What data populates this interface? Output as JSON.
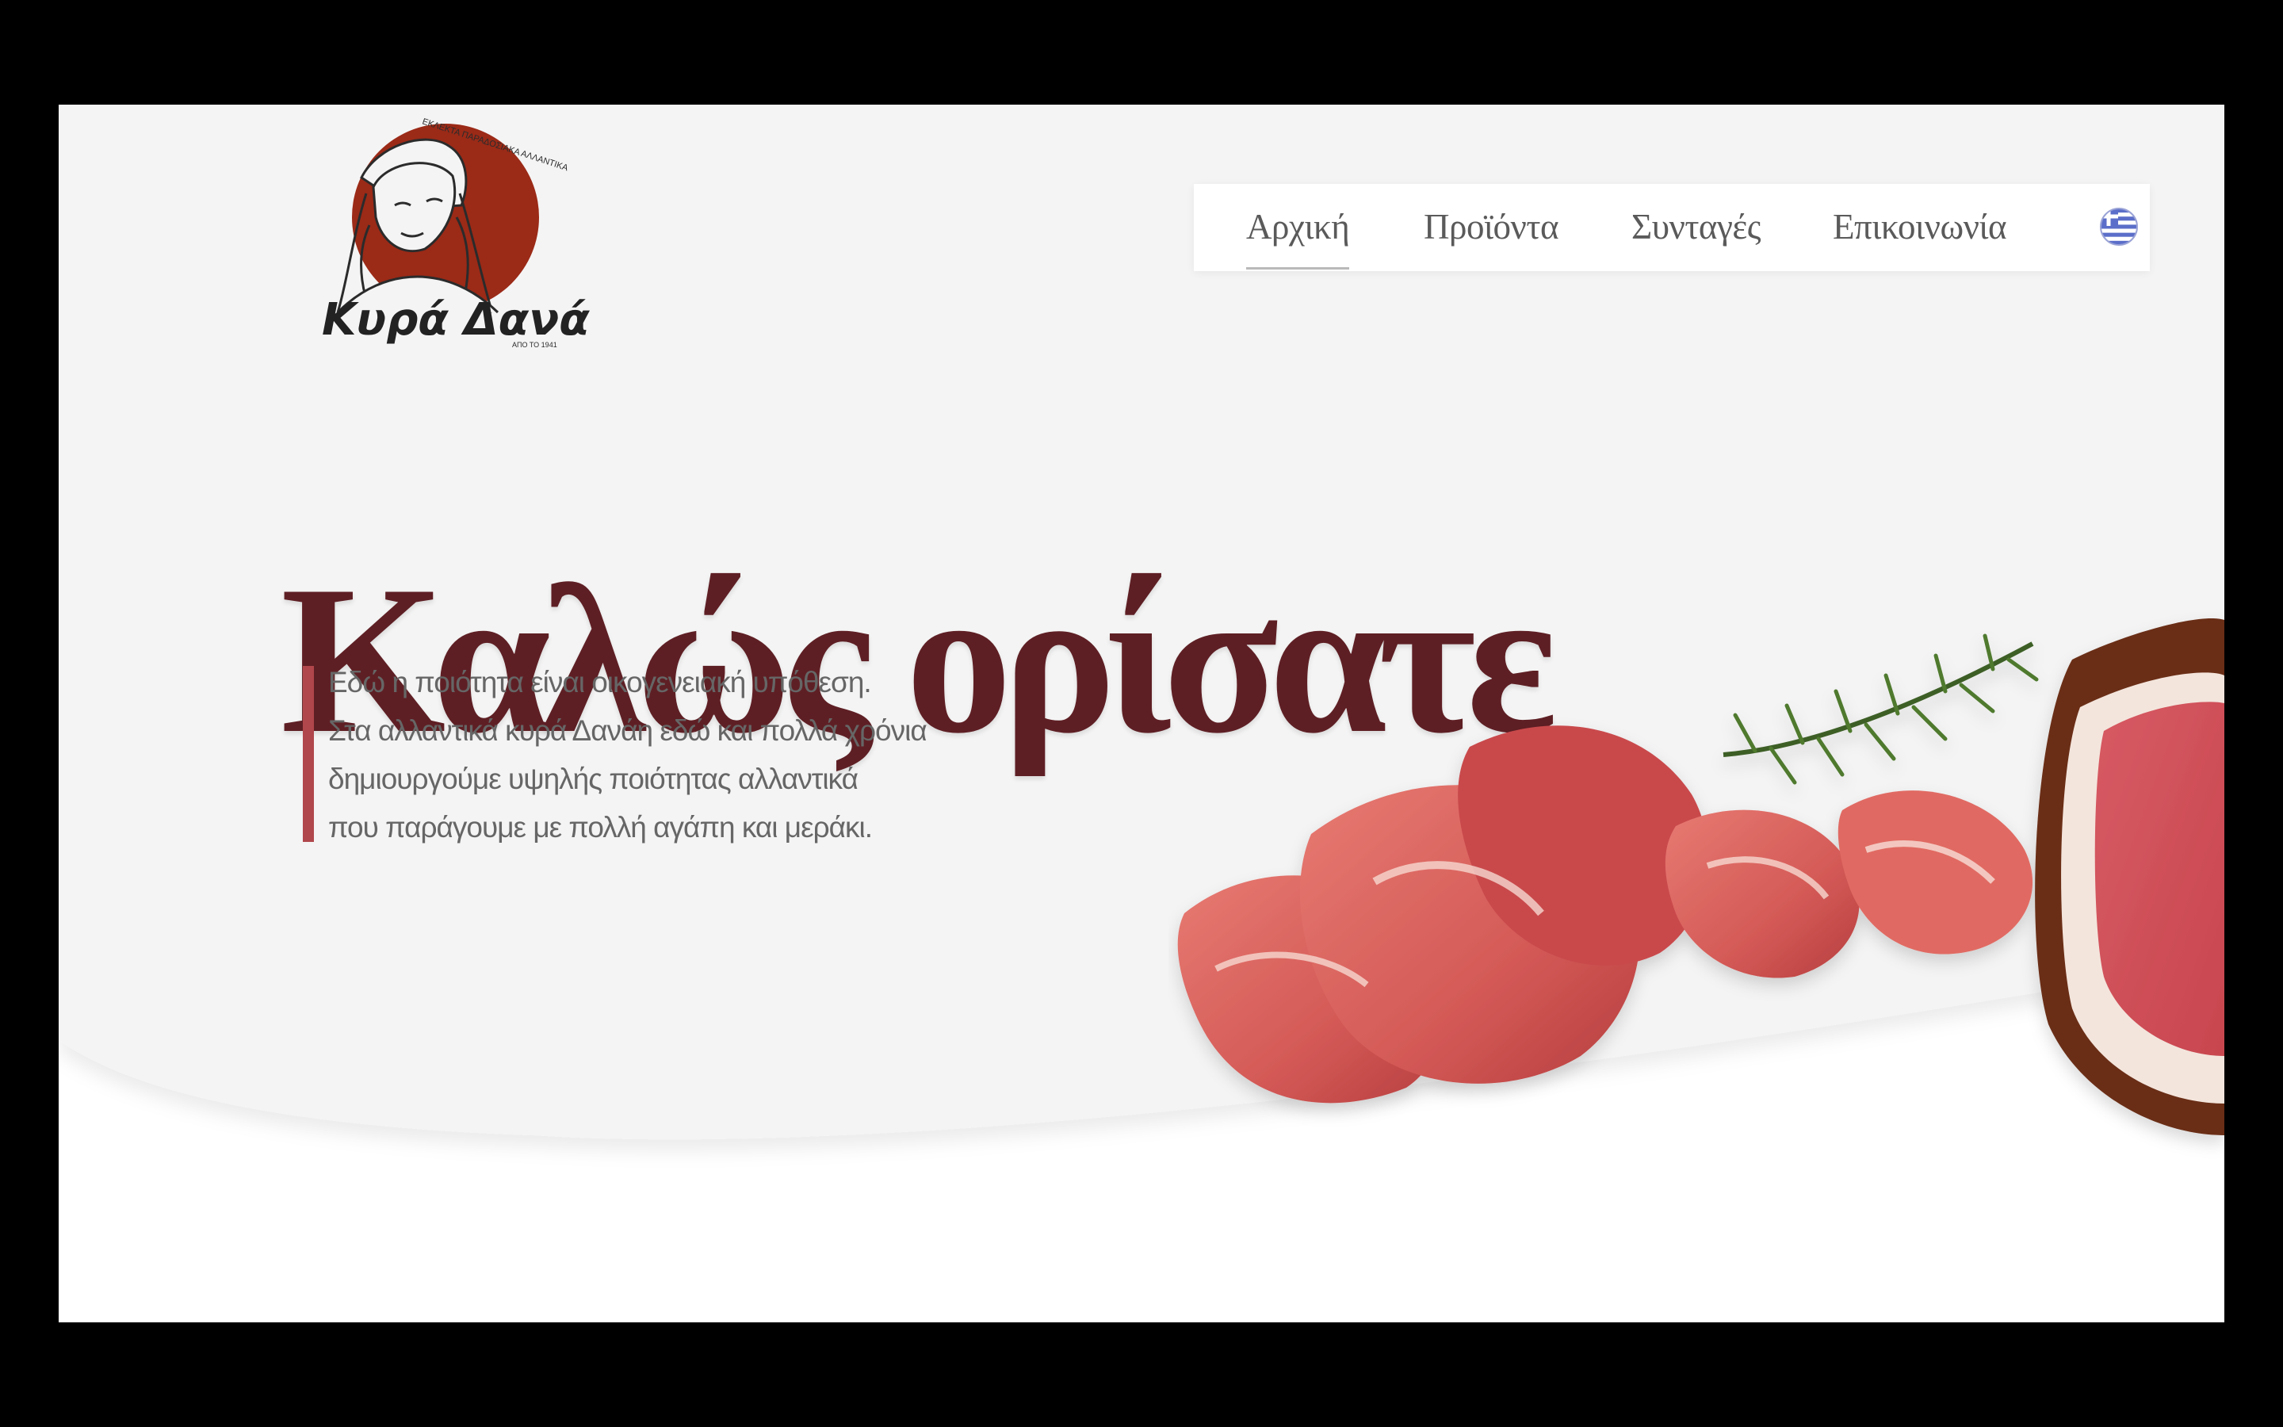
{
  "brand": {
    "name": "Κυρά Δανάη",
    "tagline": "ΕΚΛΕΚΤΑ ΠΑΡΑΔΟΣΙΑΚΑ ΑΛΛΑΝΤΙΚΑ",
    "since": "ΑΠΟ ΤΟ 1941",
    "colors": {
      "logo_circle": "#9b2a17",
      "ink": "#2b2b2b"
    }
  },
  "nav": {
    "items": [
      {
        "label": "Αρχική",
        "active": true
      },
      {
        "label": "Προϊόντα",
        "active": false
      },
      {
        "label": "Συνταγές",
        "active": false
      },
      {
        "label": "Επικοινωνία",
        "active": false
      }
    ],
    "language_icon": "greek-flag-icon"
  },
  "hero": {
    "title": "Καλώς ορίσατε",
    "intro_lines": [
      "Εδώ η ποιότητα είναι οικογενειακή υπόθεση.",
      "Στα αλλαντικά κυρά Δανάη εδώ και πολλά χρόνια",
      "δημιουργούμε υψηλής ποιότητας αλλαντικά",
      "που παράγουμε με πολλή αγάπη και μεράκι."
    ],
    "image_icon": "cured-meat-rosemary-image"
  },
  "colors": {
    "accent": "#5e1f24",
    "accent_bar": "#b0474c",
    "hero_background": "#f4f4f4",
    "page_background": "#ffffff"
  }
}
